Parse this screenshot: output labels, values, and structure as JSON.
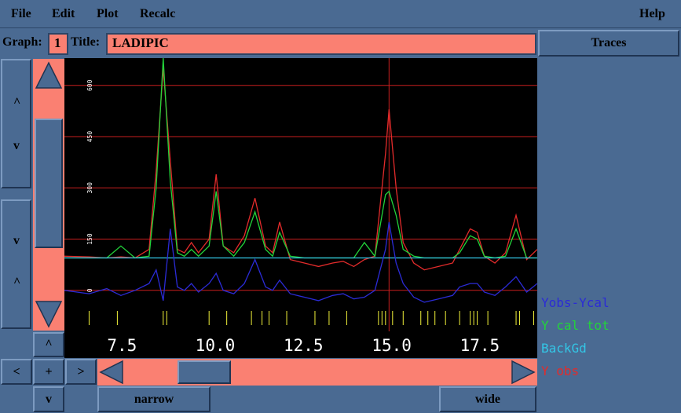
{
  "menu": {
    "file": "File",
    "edit": "Edit",
    "plot": "Plot",
    "recalc": "Recalc",
    "help": "Help"
  },
  "toolbar": {
    "graph_label": "Graph:",
    "graph_value": "1",
    "title_label": "Title:",
    "title_value": "LADIPIC",
    "traces_button": "Traces"
  },
  "left_controls": {
    "up_arrow_top": "^",
    "down_v_top": "v",
    "down_v_bottom": "v",
    "up_arrow_bottom": "^",
    "caret_up": "^",
    "nav_left": "<",
    "nav_plus": "+",
    "nav_right": ">",
    "nav_down": "v"
  },
  "bottom": {
    "narrow": "narrow",
    "wide": "wide"
  },
  "legend": [
    {
      "label": "Yobs-Ycal",
      "color": "#2b2bd6"
    },
    {
      "label": "Y cal tot",
      "color": "#22d43a"
    },
    {
      "label": "BackGd",
      "color": "#33c6e6"
    },
    {
      "label": "Y obs",
      "color": "#e32b2b"
    }
  ],
  "chart_data": {
    "type": "line",
    "xlim": [
      5.8,
      19.2
    ],
    "ylim": [
      -120,
      680
    ],
    "x_ticks": [
      "7.5",
      "10.0",
      "12.5",
      "15.0",
      "17.5"
    ],
    "x_tick_values": [
      7.5,
      10.0,
      12.5,
      15.0,
      17.5
    ],
    "y_ticks": [
      "0",
      "150",
      "300",
      "450",
      "600"
    ],
    "y_tick_values": [
      0,
      150,
      300,
      450,
      600
    ],
    "grid": true,
    "series": [
      {
        "name": "Y obs",
        "color": "#e32b2b",
        "x": [
          5.8,
          6.5,
          7.0,
          7.4,
          7.8,
          8.2,
          8.4,
          8.6,
          8.8,
          9.0,
          9.2,
          9.4,
          9.6,
          9.9,
          10.1,
          10.3,
          10.6,
          10.9,
          11.2,
          11.5,
          11.7,
          11.9,
          12.2,
          12.6,
          13.0,
          13.4,
          13.7,
          14.0,
          14.3,
          14.6,
          14.9,
          15.0,
          15.2,
          15.4,
          15.7,
          16.0,
          16.4,
          16.8,
          17.0,
          17.3,
          17.5,
          17.7,
          18.0,
          18.3,
          18.6,
          18.9,
          19.2
        ],
        "y": [
          100,
          98,
          95,
          98,
          95,
          120,
          350,
          650,
          380,
          120,
          110,
          140,
          110,
          150,
          340,
          130,
          110,
          160,
          270,
          130,
          110,
          200,
          90,
          80,
          70,
          80,
          85,
          70,
          90,
          100,
          400,
          530,
          300,
          140,
          80,
          60,
          70,
          80,
          120,
          180,
          170,
          100,
          80,
          110,
          220,
          90,
          120
        ]
      },
      {
        "name": "Y cal tot",
        "color": "#22d43a",
        "x": [
          5.8,
          6.5,
          7.0,
          7.4,
          7.8,
          8.2,
          8.4,
          8.6,
          8.8,
          9.0,
          9.2,
          9.4,
          9.6,
          9.9,
          10.1,
          10.3,
          10.6,
          10.9,
          11.2,
          11.5,
          11.7,
          11.9,
          12.2,
          12.6,
          13.0,
          13.4,
          13.7,
          14.0,
          14.3,
          14.6,
          14.9,
          15.0,
          15.2,
          15.4,
          15.7,
          16.0,
          16.4,
          16.8,
          17.0,
          17.3,
          17.5,
          17.7,
          18.0,
          18.3,
          18.6,
          18.9,
          19.2
        ],
        "y": [
          95,
          95,
          95,
          130,
          95,
          100,
          300,
          680,
          320,
          110,
          100,
          120,
          100,
          130,
          290,
          130,
          100,
          140,
          230,
          120,
          100,
          170,
          100,
          95,
          95,
          95,
          95,
          95,
          140,
          100,
          280,
          290,
          220,
          120,
          100,
          95,
          95,
          95,
          110,
          160,
          150,
          100,
          95,
          100,
          180,
          95,
          95
        ]
      },
      {
        "name": "BackGd",
        "color": "#33c6e6",
        "x": [
          5.8,
          19.2
        ],
        "y": [
          95,
          95
        ]
      },
      {
        "name": "Yobs-Ycal",
        "color": "#2b2bd6",
        "x": [
          5.8,
          6.5,
          7.0,
          7.4,
          7.8,
          8.2,
          8.4,
          8.6,
          8.8,
          9.0,
          9.2,
          9.4,
          9.6,
          9.9,
          10.1,
          10.3,
          10.6,
          10.9,
          11.2,
          11.5,
          11.7,
          11.9,
          12.2,
          12.6,
          13.0,
          13.4,
          13.7,
          14.0,
          14.3,
          14.6,
          14.9,
          15.0,
          15.2,
          15.4,
          15.7,
          16.0,
          16.4,
          16.8,
          17.0,
          17.3,
          17.5,
          17.7,
          18.0,
          18.3,
          18.6,
          18.9,
          19.2
        ],
        "y": [
          0,
          -10,
          5,
          -15,
          0,
          20,
          60,
          -30,
          180,
          10,
          0,
          20,
          -5,
          20,
          50,
          0,
          -10,
          20,
          90,
          10,
          0,
          30,
          -10,
          -20,
          -30,
          -15,
          -10,
          -25,
          -20,
          0,
          120,
          200,
          80,
          20,
          -20,
          -35,
          -25,
          -15,
          10,
          20,
          20,
          -5,
          -15,
          10,
          40,
          -5,
          20
        ]
      }
    ],
    "reflection_ticks_x": [
      6.5,
      7.3,
      8.6,
      8.7,
      9.9,
      10.4,
      11.1,
      11.4,
      11.6,
      12.1,
      12.9,
      13.3,
      13.8,
      14.7,
      14.8,
      14.9,
      15.1,
      15.4,
      15.9,
      16.1,
      16.3,
      16.6,
      17.0,
      17.3,
      17.4,
      17.5,
      17.8,
      18.6,
      18.7,
      19.1
    ]
  }
}
